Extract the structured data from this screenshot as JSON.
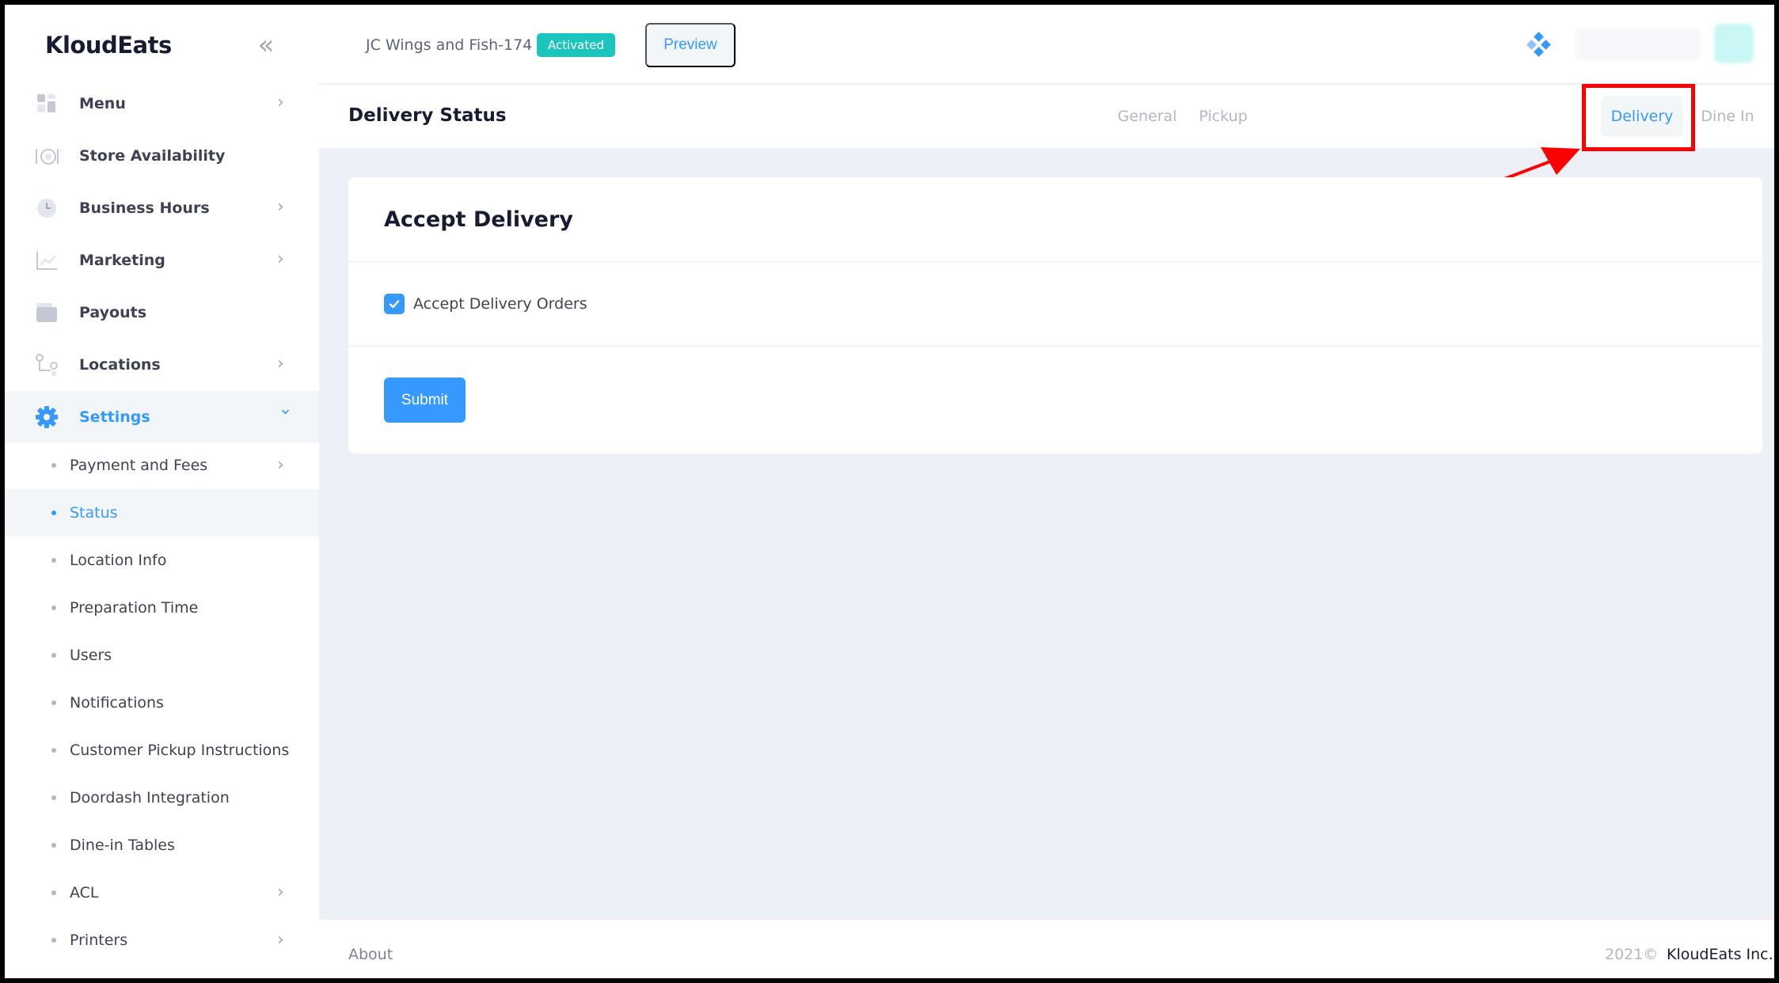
{
  "brand": "KloudEats",
  "sidebar": {
    "items": [
      {
        "label": "Menu",
        "icon": "menu-grid-icon"
      },
      {
        "label": "Store Availability",
        "icon": "dining-icon"
      },
      {
        "label": "Business Hours",
        "icon": "clock-icon"
      },
      {
        "label": "Marketing",
        "icon": "chart-line-icon"
      },
      {
        "label": "Payouts",
        "icon": "wallet-icon"
      },
      {
        "label": "Locations",
        "icon": "route-icon"
      },
      {
        "label": "Settings",
        "icon": "gear-icon"
      }
    ],
    "subitems": [
      {
        "label": "Payment and Fees"
      },
      {
        "label": "Status"
      },
      {
        "label": "Location Info"
      },
      {
        "label": "Preparation Time"
      },
      {
        "label": "Users"
      },
      {
        "label": "Notifications"
      },
      {
        "label": "Customer Pickup Instructions"
      },
      {
        "label": "Doordash Integration"
      },
      {
        "label": "Dine-in Tables"
      },
      {
        "label": "ACL"
      },
      {
        "label": "Printers"
      }
    ]
  },
  "header": {
    "store_name": "JC Wings and Fish-174",
    "status_badge": "Activated",
    "preview_label": "Preview"
  },
  "subheader": {
    "title": "Delivery Status",
    "tabs": [
      {
        "label": "General"
      },
      {
        "label": "Pickup"
      },
      {
        "label": "Delivery"
      },
      {
        "label": "Dine In"
      }
    ]
  },
  "card": {
    "title": "Accept Delivery",
    "checkbox_label": "Accept Delivery Orders",
    "checkbox_checked": true,
    "submit_label": "Submit"
  },
  "footer": {
    "about": "About",
    "year": "2021©",
    "company": "KloudEats Inc."
  },
  "colors": {
    "accent": "#3699ff",
    "badge": "#1bc5bd",
    "annotation": "#ff0000"
  }
}
